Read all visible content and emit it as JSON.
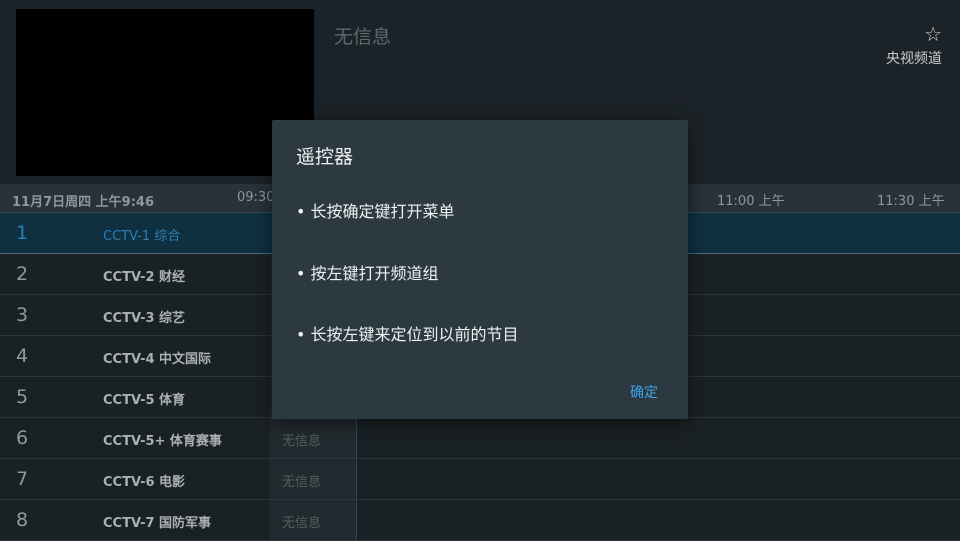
{
  "preview": {
    "program_title": "无信息",
    "favorite_icon": "star-outline-icon",
    "channel_group": "央视频道"
  },
  "timeline": {
    "date": "11月7日周四 上午9:46",
    "ticks": [
      "09:30",
      "11:00 上午",
      "11:30 上午"
    ]
  },
  "channels": [
    {
      "number": "1",
      "name": "CCTV-1 综合",
      "program": ""
    },
    {
      "number": "2",
      "name": "CCTV-2 财经",
      "program": ""
    },
    {
      "number": "3",
      "name": "CCTV-3 综艺",
      "program": ""
    },
    {
      "number": "4",
      "name": "CCTV-4 中文国际",
      "program": ""
    },
    {
      "number": "5",
      "name": "CCTV-5 体育",
      "program": ""
    },
    {
      "number": "6",
      "name": "CCTV-5+ 体育赛事",
      "program": "无信息"
    },
    {
      "number": "7",
      "name": "CCTV-6 电影",
      "program": "无信息"
    },
    {
      "number": "8",
      "name": "CCTV-7 国防军事",
      "program": "无信息"
    }
  ],
  "dialog": {
    "title": "遥控器",
    "lines": [
      "• 长按确定键打开菜单",
      "• 按左键打开频道组",
      "• 长按左键来定位到以前的节目"
    ],
    "ok_label": "确定"
  }
}
